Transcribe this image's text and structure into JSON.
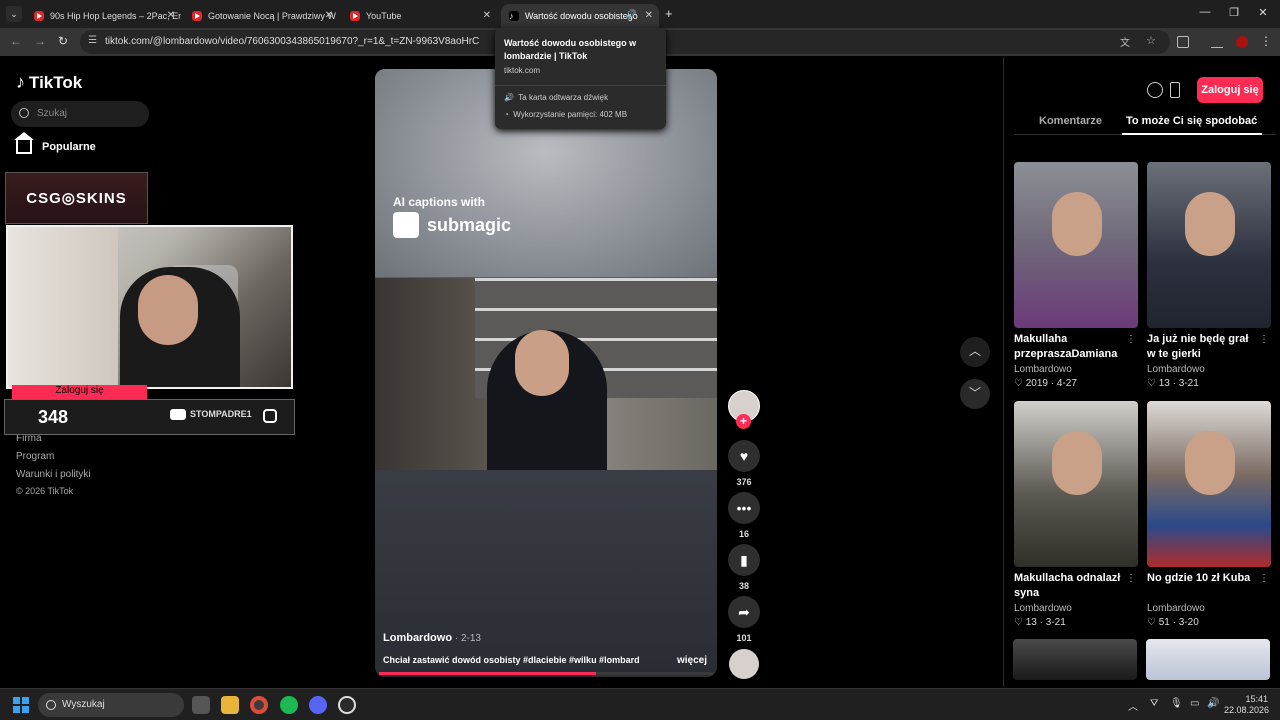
{
  "browser": {
    "tabs": [
      {
        "label": "90s Hip Hop Legends – 2Pac, Em"
      },
      {
        "label": "Gotowanie Nocą | Prawdziwy W"
      },
      {
        "label": "YouTube"
      },
      {
        "label": "Wartość dowodu osobistego"
      }
    ],
    "url": "tiktok.com/@lombardowo/video/7606300343865019670?_r=1&_t=ZN-9963V8aoHrC",
    "tooltip": {
      "title": "Wartość dowodu osobistego w lombardzie | TikTok",
      "domain": "tiktok.com",
      "audio": "Ta karta odtwarza dźwięk",
      "memory": "Wykorzystanie pamięci: 402 MB"
    }
  },
  "sidebar": {
    "logo": "TikTok",
    "search_placeholder": "Szukaj",
    "popular": "Popularne",
    "footer": [
      "Firma",
      "Program",
      "Warunki i polityki",
      "© 2026 TikTok"
    ]
  },
  "overlay": {
    "brand": "CSG◎SKINS",
    "login_strip": "Zaloguj się",
    "counter": "348",
    "youtube_handle": "STOMPADRE1"
  },
  "video": {
    "caption_line1": "AI captions with",
    "caption_line2": "submagic",
    "author": "Lombardowo",
    "date": " · 2-13",
    "description": "Chciał zastawić dowód osobisty #dlaciebie #wilku #lombard",
    "more": "więcej",
    "progress": 0.65
  },
  "actions": {
    "likes": "376",
    "comments": "16",
    "saves": "38",
    "shares": "101"
  },
  "right_panel": {
    "login_button": "Zaloguj się",
    "tab_comments": "Komentarze",
    "tab_recommended": "To może Ci się spodobać",
    "cards": [
      {
        "title": "Makullaha przepraszaDamiana",
        "author": "Lombardowo",
        "meta": "2019 · 4-27"
      },
      {
        "title": "Ja już nie będę grał w te gierki",
        "author": "Lombardowo",
        "meta": "13 · 3-21"
      },
      {
        "title": "Makullacha odnalazł syna",
        "author": "Lombardowo",
        "meta": "13 · 3-21"
      },
      {
        "title": "No gdzie 10 zł Kuba",
        "author": "Lombardowo",
        "meta": "51 · 3-20"
      }
    ]
  },
  "taskbar": {
    "search_placeholder": "Wyszukaj",
    "time": "15:41",
    "date": "22.08.2026"
  }
}
